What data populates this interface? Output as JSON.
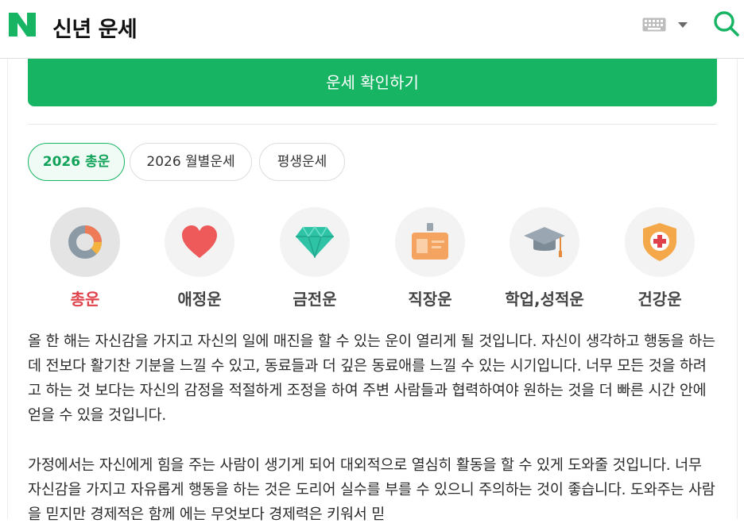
{
  "header": {
    "title": "신년 운세",
    "logo_letter": "N",
    "brand_color": "#17b463"
  },
  "cta": {
    "label": "운세 확인하기"
  },
  "tabs": [
    {
      "label": "2026 총운",
      "active": true
    },
    {
      "label": "2026 월별운세",
      "active": false
    },
    {
      "label": "평생운세",
      "active": false
    }
  ],
  "categories": [
    {
      "label": "총운",
      "icon": "donut-chart-icon",
      "active": true
    },
    {
      "label": "애정운",
      "icon": "heart-icon",
      "active": false
    },
    {
      "label": "금전운",
      "icon": "diamond-icon",
      "active": false
    },
    {
      "label": "직장운",
      "icon": "id-badge-icon",
      "active": false
    },
    {
      "label": "학업,성적운",
      "icon": "graduation-cap-icon",
      "active": false
    },
    {
      "label": "건강운",
      "icon": "health-shield-icon",
      "active": false
    }
  ],
  "paragraphs": [
    "올 한 해는 자신감을 가지고 자신의 일에 매진을 할 수 있는 운이 열리게 될 것입니다. 자신이 생각하고 행동을 하는데 전보다 활기찬 기분을 느낄 수 있고, 동료들과 더 깊은 동료애를 느낄 수 있는 시기입니다. 너무 모든 것을 하려고 하는 것 보다는 자신의 감정을 적절하게 조정을 하여 주변 사람들과 협력하여야 원하는 것을 더 빠른 시간 안에 얻을 수 있을 것입니다.",
    "가정에서는 자신에게 힘을 주는 사람이 생기게 되어 대외적으로 열심히 활동을 할 수 있게 도와줄 것입니다. 너무 자신감을 가지고 자유롭게 행동을 하는 것은 도리어 실수를 부를 수 있으니 주의하는 것이 좋습니다. 도와주는 사람을 믿지만 경제적은 함께 에는 무엇보다 경제력은 키워서 믿"
  ]
}
